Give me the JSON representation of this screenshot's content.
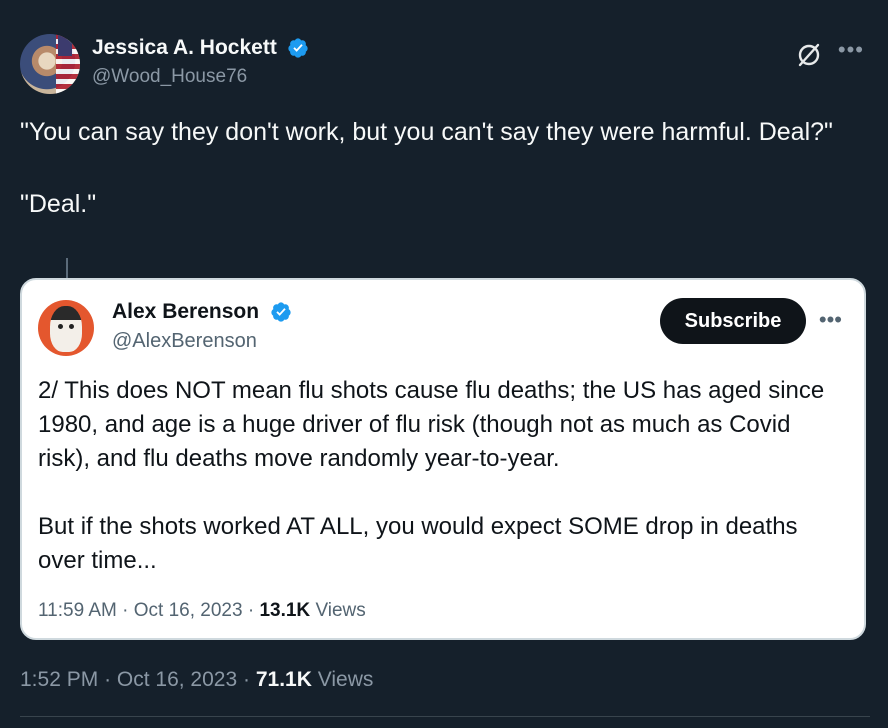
{
  "tweet": {
    "author": {
      "display_name": "Jessica A. Hockett",
      "handle": "@Wood_House76",
      "verified": true
    },
    "text": "\"You can say they don't work, but you can't say they were harmful. Deal?\"\n\n\"Deal.\"",
    "time": "1:52 PM",
    "date": "Oct 16, 2023",
    "views_count": "71.1K",
    "views_label": "Views"
  },
  "quote": {
    "author": {
      "display_name": "Alex Berenson",
      "handle": "@AlexBerenson",
      "verified": true
    },
    "subscribe_label": "Subscribe",
    "text": "2/ This does NOT mean flu shots cause flu deaths; the US has aged since 1980, and age is a huge driver of flu risk (though not as much as Covid risk), and flu deaths move randomly year-to-year.\n\nBut if the shots worked AT ALL, you would expect SOME drop in deaths over time...",
    "time": "11:59 AM",
    "date": "Oct 16, 2023",
    "views_count": "13.1K",
    "views_label": "Views"
  },
  "separator": "·",
  "icons": {
    "verified": "verified-badge-icon",
    "grok": "grok-icon",
    "more": "more-icon"
  },
  "colors": {
    "background": "#15202b",
    "verified_blue": "#1d9bf0",
    "muted_text": "#8b98a5"
  }
}
